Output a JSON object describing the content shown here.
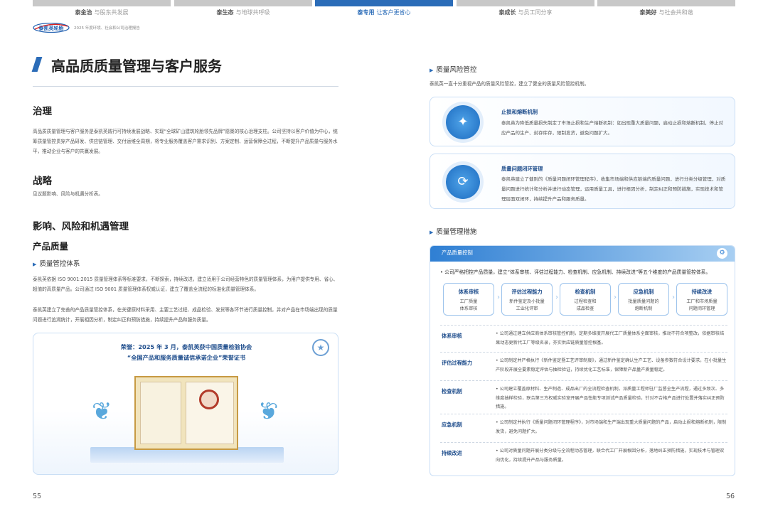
{
  "tabs": [
    {
      "bold": "泰金治",
      "label": "与股东共发展"
    },
    {
      "bold": "泰生态",
      "label": "与地球共呼吸"
    },
    {
      "bold": "泰专用",
      "label": "让客户更省心"
    },
    {
      "bold": "泰成长",
      "label": "与员工同分享"
    },
    {
      "bold": "泰美好",
      "label": "与社会共和谐"
    }
  ],
  "header": {
    "logo_text": "泰凯英轮胎",
    "report_title": "2025 年度环境、社会和公司治理报告"
  },
  "left": {
    "title": "高品质质量管理与客户服务",
    "gov_heading": "治理",
    "gov_text": "高品质质量管理与客户服务是泰凯英践行可持续发展战略、实现“全球矿山建筑轮胎领先品牌”愿景的核心治理支柱。公司坚持以客户价值为中心，统筹质量管控贯穿产品研发、供应链管理、交付运维全周期，将专业服务覆盖客户需求识别、方案定制、运营保障全过程，不断提升产品质量与服务水平，推动企业与客户的共赢发展。",
    "strategy_heading": "战略",
    "strategy_text": "见议题影响、风险与机遇分析表。",
    "irm_heading": "影响、风险和机遇管理",
    "product_quality": "产品质量",
    "qms_heading": "质量管控体系",
    "qms_text1": "泰凯英依据 ISO 9001:2015 质量管理体系等标准要求，不断探索，持续改进，建立适用于公司经营特色的质量管理体系，为用户提供专用、省心、超值的高质量产品。公司通过 ISO 9001 质量管理体系权威认证，建立了覆盖全流程的标准化质量管理体系。",
    "qms_text2": "泰凯英建立了完善的产品质量管控体系，在关键原材料采用、主要工艺过程、成品检验、发货等各环节进行质量控制，并对产品在市场端出现的质量问题进行追溯统计，开展相因分析，制定纠正和预防措施，持续提升产品和服务质量。",
    "honor_line1": "荣誉：2025 年 3 月，泰凯英获中国质量检验协会",
    "honor_line2": "“全国产品和服务质量诚信承诺企业”荣誉证书"
  },
  "right": {
    "risk_heading": "质量风险管控",
    "risk_intro": "泰凯英一直十分重视产品的质量风险管控，建立了健全的质量风险管控机制。",
    "card1_title": "止损和熔断机制",
    "card1_text": "泰凯英为降低质量损失制定了市场止损和生产熔断机制：如出现重大质量问题，启动止损和熔断机制，停止对应产品的生产、封存库存，限制发货，避免问题扩大。",
    "card2_title": "质量问题闭环管理",
    "card2_text": "泰凯英建立了健则的《质量问题闭环管理程序》，收集市场端和供应链端的质量问题，进行分类分级管理，对质量问题进行统计和分析并进行动态管理，运用质量工具，进行根因分析，制定纠正和预防措施，实现技术和管理层面双闭环，持续提升产品和服务质量。",
    "measures_heading": "质量管理措施",
    "box_title": "产品质量控制",
    "box_intro": "• 公司严格把控产品质量，建立“体系审核、评估过程能力、检查机制、应急机制、持续改进”等五个维度的产品质量管控体系。",
    "steps": [
      {
        "title": "体系审核",
        "desc1": "工厂质量",
        "desc2": "体系审核"
      },
      {
        "title": "评估过程能力",
        "desc1": "新件鉴定及小批量",
        "desc2": "工业化评审"
      },
      {
        "title": "检查机制",
        "desc1": "过程检查和",
        "desc2": "成品检查"
      },
      {
        "title": "应急机制",
        "desc1": "批量质量问题的",
        "desc2": "熔断机制"
      },
      {
        "title": "持续改进",
        "desc1": "工厂和市场质量",
        "desc2": "问题闭环管理"
      }
    ],
    "rows": [
      {
        "label": "体系审核",
        "text": "• 公司通过建立供应商体系审核管控机制，定期多维度开展代工厂质量体系全面审核，推动不符合项整改，依据审核结果动态更新代工厂等级名录，夯实供应链质量管控根基。"
      },
      {
        "label": "评估过程能力",
        "text": "• 公司制定并严格执行《新件鉴定暨工艺评审制度》，通过新件鉴定确认生产工艺、设备参数符合设计要求，在小批量生产阶段开展全要素稳定评估与抽检验证，持续优化工艺标准，保障新产品量产质量稳定。"
      },
      {
        "label": "检查机制",
        "text": "• 公司建立覆盖原材料、生产制造、成品出厂的全流程检查机制，派质量工程师驻厂监督全生产流程，通过多频次、多维度抽样检验，联合第三方权威实验室开展产品性能专项测试产品质量检验，针对不合格产品进行处置并落实纠正预防措施。"
      },
      {
        "label": "应急机制",
        "text": "• 公司制定并执行《质量问题闭环管理程序》，对市场端和生产端出现重大质量问题的产品，启动止损和熔断机制，限制发货，避免问题扩大。"
      },
      {
        "label": "持续改进",
        "text": "• 公司对质量问题开展分类分级与全流程动态管理，联合代工厂开展根因分析，落地纠正预防措施，实现技术与管理双向优化，持续提升产品与服务质量。"
      }
    ]
  },
  "pages": {
    "left": "55",
    "right": "56"
  }
}
